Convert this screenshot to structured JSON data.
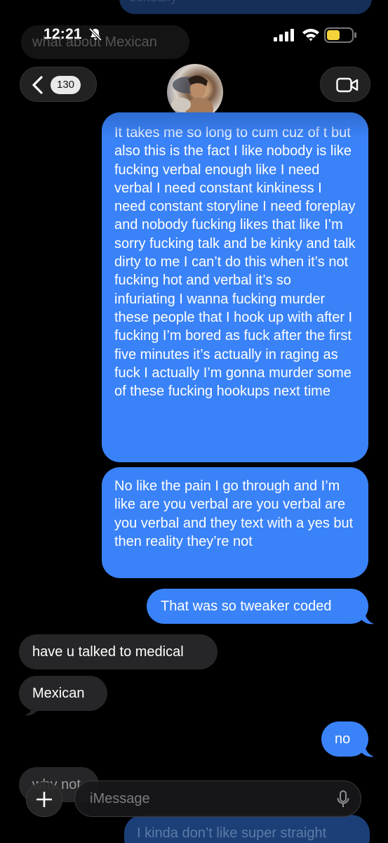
{
  "status_bar": {
    "time": "12:21"
  },
  "background_messages": {
    "top_outgoing": "sexually",
    "top_incoming": "what about Mexican",
    "bottom_outgoing": "I kinda don’t like super straight"
  },
  "header": {
    "unread_count": "130"
  },
  "messages": [
    {
      "side": "out",
      "text": "It takes me so long to cum cuz of t but also this is the fact I like nobody is like fucking verbal enough like I need verbal I need constant kinkiness I need constant storyline I need foreplay and nobody fucking likes that like I’m sorry fucking talk and be kinky and talk dirty to me I can’t do this when it’s not fucking hot and verbal it’s so infuriating I wanna fucking murder these people that I hook up with after I fucking I’m bored as fuck after the first five minutes it’s actually in raging as fuck I actually I’m gonna murder some of these fucking hookups next time"
    },
    {
      "side": "out",
      "text": "No like the pain I go through and I’m like are you verbal are you verbal are you verbal and they text with a yes but then reality they’re not"
    },
    {
      "side": "out",
      "text": "That was so tweaker coded"
    },
    {
      "side": "in",
      "text": "have u talked to medical"
    },
    {
      "side": "in",
      "text": "Mexican"
    },
    {
      "side": "out",
      "text": "no"
    },
    {
      "side": "in",
      "text": "why not"
    }
  ],
  "composer": {
    "placeholder": "iMessage"
  },
  "colors": {
    "outgoing_bubble": "#3a82f7",
    "incoming_bubble": "#262628",
    "background": "#000000",
    "battery": "#f5d33b"
  }
}
